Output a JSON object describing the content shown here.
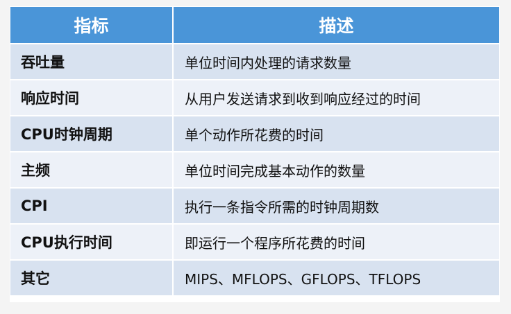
{
  "table": {
    "headers": [
      "指标",
      "描述"
    ],
    "rows": [
      {
        "name": "吞吐量",
        "desc": "单位时间内处理的请求数量"
      },
      {
        "name": "响应时间",
        "desc": "从用户发送请求到收到响应经过的时间"
      },
      {
        "name": "CPU时钟周期",
        "desc": "单个动作所花费的时间"
      },
      {
        "name": "主频",
        "desc": "单位时间完成基本动作的数量"
      },
      {
        "name": "CPI",
        "desc": "执行一条指令所需的时钟周期数"
      },
      {
        "name": "CPU执行时间",
        "desc": "即运行一个程序所花费的时间"
      },
      {
        "name": "其它",
        "desc": "MIPS、MFLOPS、GFLOPS、TFLOPS"
      }
    ]
  },
  "colors": {
    "header_bg": "#4a95d8",
    "header_text": "#ffffff",
    "row_odd_bg": "#d8e2f0",
    "row_even_bg": "#edf1f8",
    "page_bg": "#f4f4f4"
  }
}
